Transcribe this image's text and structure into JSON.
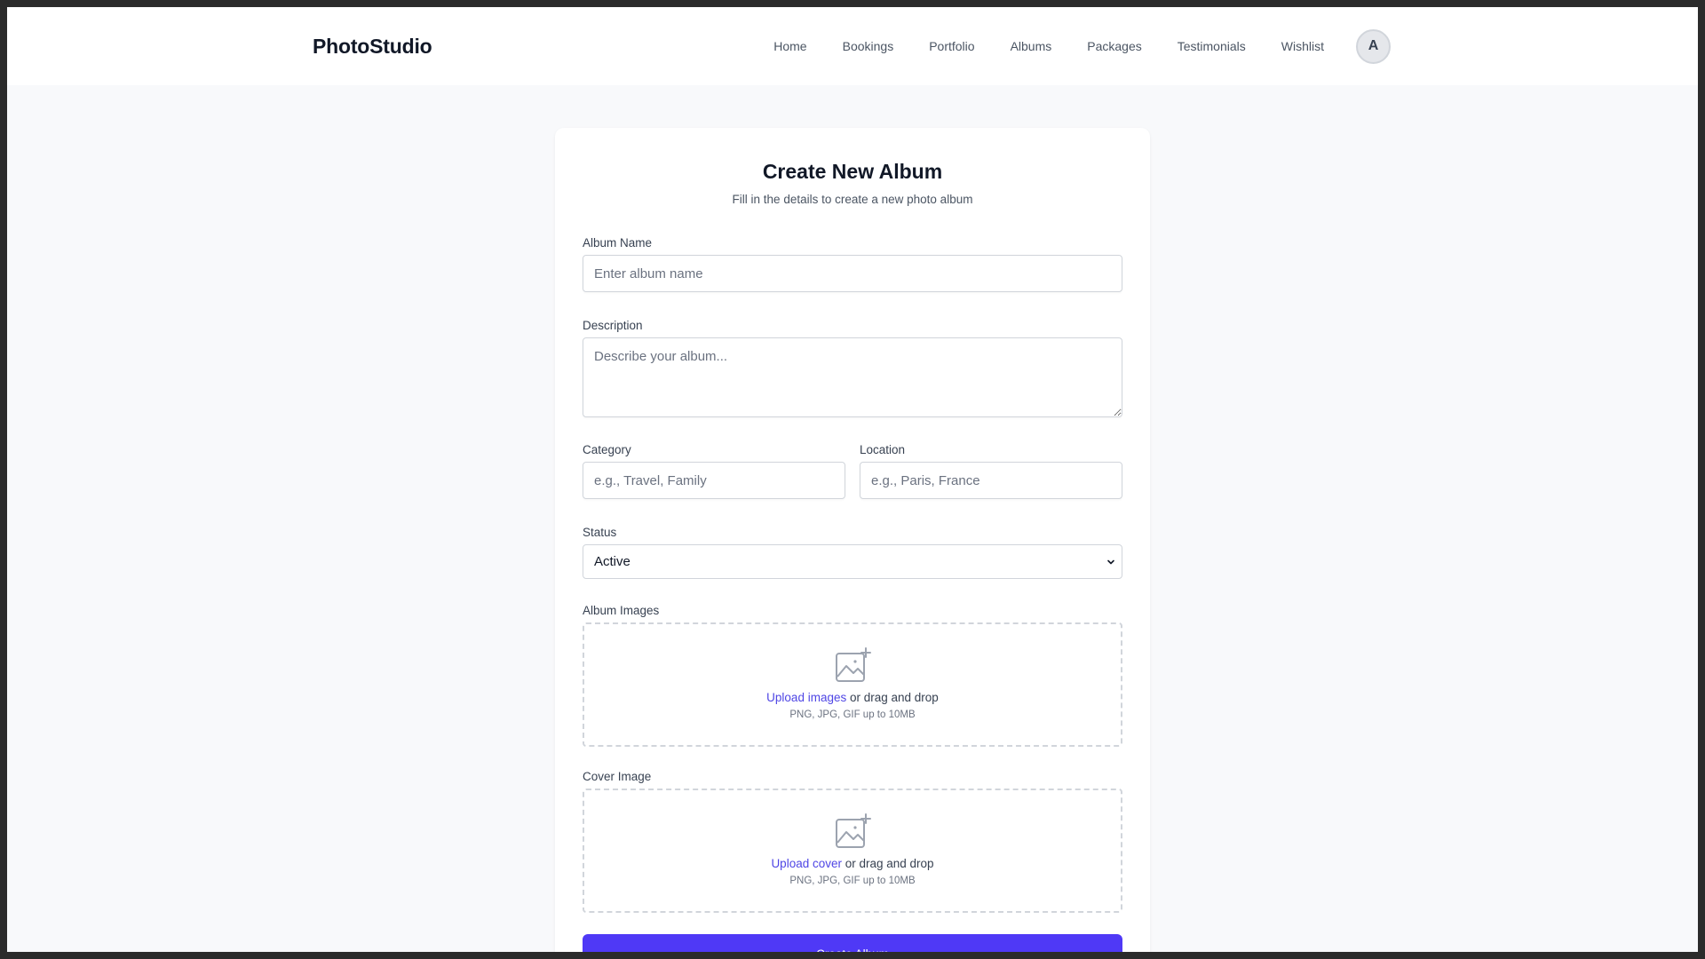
{
  "header": {
    "brand": "PhotoStudio",
    "nav": [
      "Home",
      "Bookings",
      "Portfolio",
      "Albums",
      "Packages",
      "Testimonials",
      "Wishlist"
    ],
    "avatar_initial": "A"
  },
  "form": {
    "title": "Create New Album",
    "subtitle": "Fill in the details to create a new photo album",
    "album_name": {
      "label": "Album Name",
      "placeholder": "Enter album name",
      "value": ""
    },
    "description": {
      "label": "Description",
      "placeholder": "Describe your album...",
      "value": ""
    },
    "category": {
      "label": "Category",
      "placeholder": "e.g., Travel, Family",
      "value": ""
    },
    "location": {
      "label": "Location",
      "placeholder": "e.g., Paris, France",
      "value": ""
    },
    "status": {
      "label": "Status",
      "selected": "Active"
    },
    "album_images": {
      "label": "Album Images",
      "link": "Upload images",
      "rest": " or drag and drop",
      "hint": "PNG, JPG, GIF up to 10MB",
      "icon": "image-plus-icon"
    },
    "cover_image": {
      "label": "Cover Image",
      "link": "Upload cover",
      "rest": " or drag and drop",
      "hint": "PNG, JPG, GIF up to 10MB",
      "icon": "image-plus-icon"
    },
    "submit_label": "Create Album"
  },
  "colors": {
    "accent": "#4f39f6",
    "link": "#4f46e5",
    "page_bg": "#f8f9fb"
  }
}
